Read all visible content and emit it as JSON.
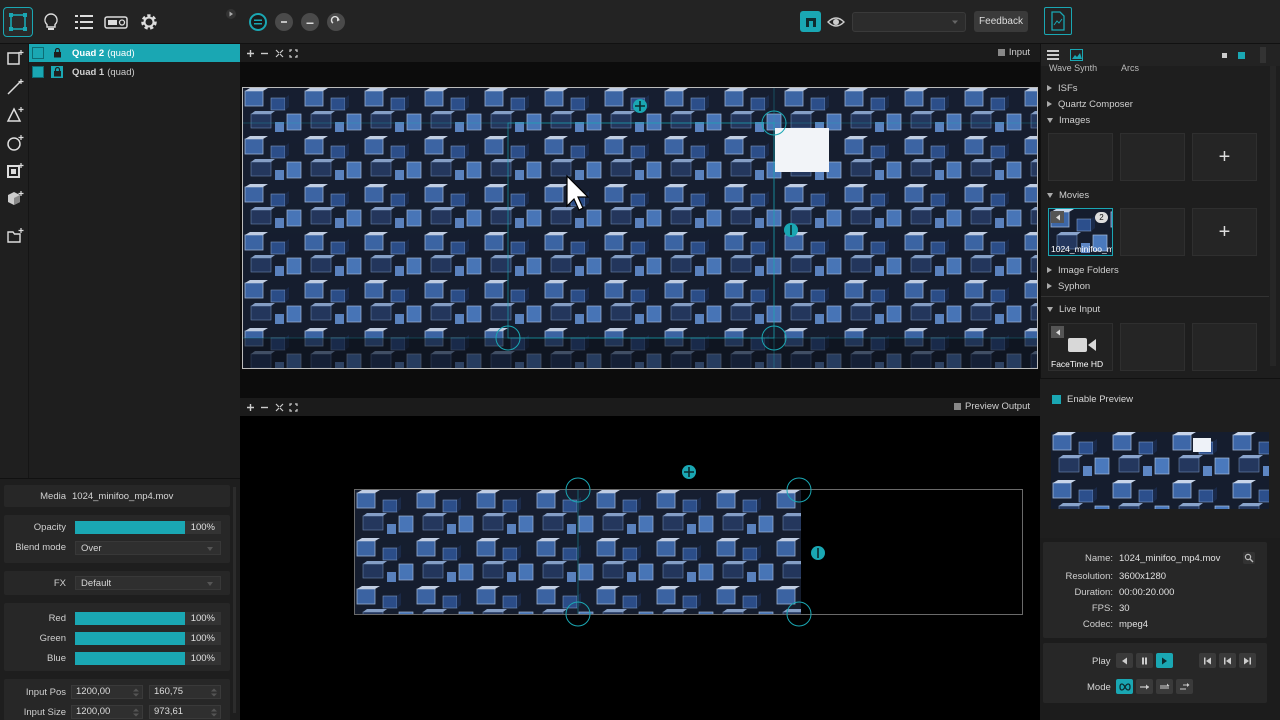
{
  "colors": {
    "accent": "#1aa7b3",
    "panel": "#1e1e1e",
    "canvas": "#0c0c0c"
  },
  "toolbar": {
    "feedback_label": "Feedback",
    "output_select_value": ""
  },
  "layers": [
    {
      "name": "Quad 2",
      "type": "(quad)",
      "selected": true
    },
    {
      "name": "Quad 1",
      "type": "(quad)",
      "selected": false
    }
  ],
  "canvas": {
    "input_title": "Input",
    "output_title": "Preview Output"
  },
  "inspector": {
    "media_label": "Media",
    "media_value": "1024_minifoo_mp4.mov",
    "opacity_label": "Opacity",
    "opacity_value": "100%",
    "opacity_level": 1.0,
    "blend_label": "Blend mode",
    "blend_value": "Over",
    "fx_label": "FX",
    "fx_value": "Default",
    "red_label": "Red",
    "red_value": "100%",
    "green_label": "Green",
    "green_value": "100%",
    "blue_label": "Blue",
    "blue_value": "100%",
    "input_pos_label": "Input Pos",
    "input_pos_x": "1200,00",
    "input_pos_y": "160,75",
    "input_size_label": "Input Size",
    "input_size_w": "1200,00",
    "input_size_h": "973,61"
  },
  "browser": {
    "top_partial_1": "Wave Synth",
    "top_partial_2": "Arcs",
    "categories": {
      "isfs": "ISFs",
      "quartz": "Quartz Composer",
      "images": "Images",
      "movies": "Movies",
      "image_folders": "Image Folders",
      "syphon": "Syphon",
      "live_input": "Live Input"
    },
    "movie_thumb_label": "1024_minifoo_m",
    "movie_badge": "2",
    "live_thumb_label": "FaceTime HD",
    "add_symbol": "+"
  },
  "preview": {
    "enable_label": "Enable Preview"
  },
  "info": {
    "name_key": "Name:",
    "name_val": "1024_minifoo_mp4.mov",
    "res_key": "Resolution:",
    "res_val": "3600x1280",
    "dur_key": "Duration:",
    "dur_val": "00:00:20.000",
    "fps_key": "FPS:",
    "fps_val": "30",
    "codec_key": "Codec:",
    "codec_val": "mpeg4"
  },
  "transport": {
    "play_label": "Play",
    "mode_label": "Mode"
  }
}
